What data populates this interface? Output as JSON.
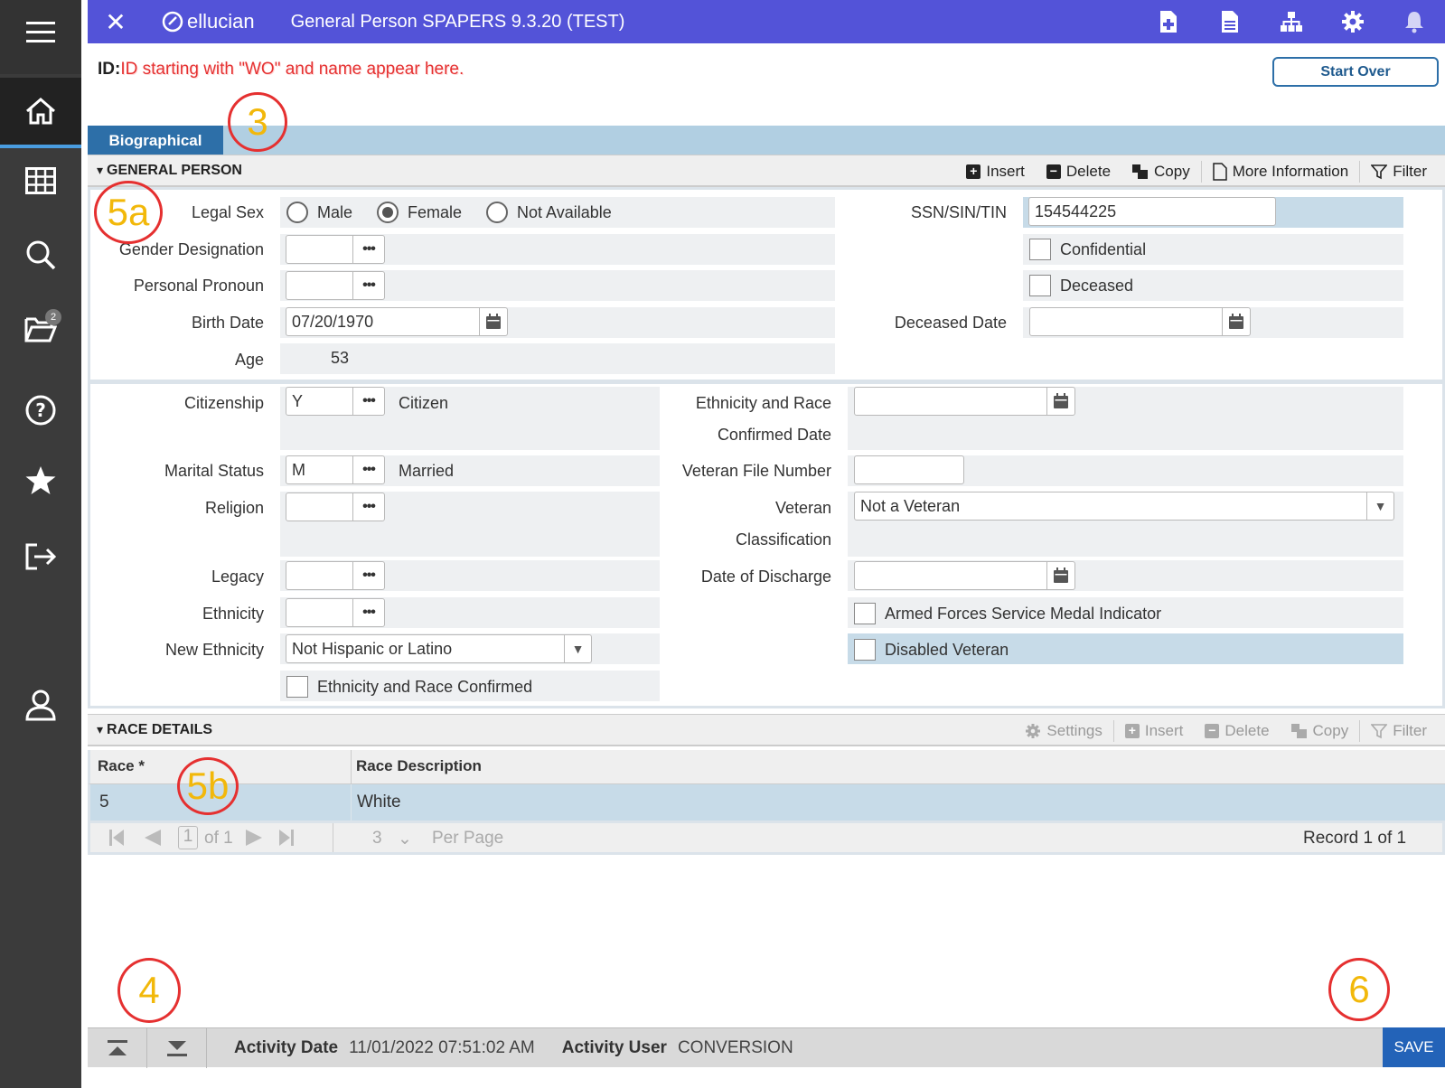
{
  "header": {
    "close_label": "✕",
    "brand": "ellucian",
    "title": "General Person SPAPERS 9.3.20 (TEST)"
  },
  "rail": {
    "items": [
      "menu-icon",
      "home-icon",
      "grid-icon",
      "search-icon",
      "folder-icon",
      "help-icon",
      "star-icon",
      "signout-icon",
      "user-icon"
    ],
    "folder_badge": "2"
  },
  "idbar": {
    "label": "ID:",
    "note": "ID starting with \"WO\" and name appear here.",
    "start_over": "Start Over"
  },
  "tab": {
    "label": "Biographical"
  },
  "general_person": {
    "title": "GENERAL PERSON",
    "actions": [
      "Insert",
      "Delete",
      "Copy",
      "More Information",
      "Filter"
    ],
    "legal_sex_label": "Legal Sex",
    "legal_sex_options": [
      "Male",
      "Female",
      "Not Available"
    ],
    "legal_sex_selected": "Female",
    "gender_designation_label": "Gender Designation",
    "personal_pronoun_label": "Personal Pronoun",
    "birth_date_label": "Birth Date",
    "birth_date": "07/20/1970",
    "age_label": "Age",
    "age": "53",
    "ssn_label": "SSN/SIN/TIN",
    "ssn": "154544225",
    "confidential_label": "Confidential",
    "deceased_label": "Deceased",
    "deceased_date_label": "Deceased Date"
  },
  "citizenship_block": {
    "citizenship_label": "Citizenship",
    "citizenship_code": "Y",
    "citizenship_desc": "Citizen",
    "marital_label": "Marital Status",
    "marital_code": "M",
    "marital_desc": "Married",
    "religion_label": "Religion",
    "legacy_label": "Legacy",
    "ethnicity_label": "Ethnicity",
    "new_ethnicity_label": "New Ethnicity",
    "new_ethnicity_value": "Not Hispanic or Latino",
    "eth_race_confirmed_label": "Ethnicity and Race Confirmed",
    "eth_race_date_label_1": "Ethnicity and Race",
    "eth_race_date_label_2": "Confirmed Date",
    "veteran_file_label": "Veteran File Number",
    "veteran_class_label_1": "Veteran",
    "veteran_class_label_2": "Classification",
    "veteran_class_value": "Not a Veteran",
    "discharge_label": "Date of Discharge",
    "armed_forces_label": "Armed Forces Service Medal Indicator",
    "disabled_veteran_label": "Disabled Veteran"
  },
  "race_details": {
    "title": "RACE DETAILS",
    "actions": [
      "Settings",
      "Insert",
      "Delete",
      "Copy",
      "Filter"
    ],
    "columns": [
      "Race *",
      "Race Description"
    ],
    "rows": [
      {
        "race": "5",
        "description": "White"
      }
    ],
    "pager": {
      "page": "1",
      "of": "of 1",
      "per_page_value": "3",
      "per_page_label": "Per Page",
      "record": "Record 1 of 1"
    }
  },
  "annotations": [
    "3",
    "5a",
    "5b",
    "4",
    "6"
  ],
  "footer": {
    "activity_date_label": "Activity Date",
    "activity_date": "11/01/2022 07:51:02 AM",
    "activity_user_label": "Activity User",
    "activity_user": "CONVERSION",
    "save": "SAVE"
  },
  "colors": {
    "header_bg": "#5353d8",
    "tab_bg": "#2d6fa8",
    "rail_bg": "#3b3b3b",
    "annotation_circle": "#e53030",
    "annotation_text": "#f2b80a",
    "note_text": "#e53030",
    "save_bg": "#2363b8"
  }
}
